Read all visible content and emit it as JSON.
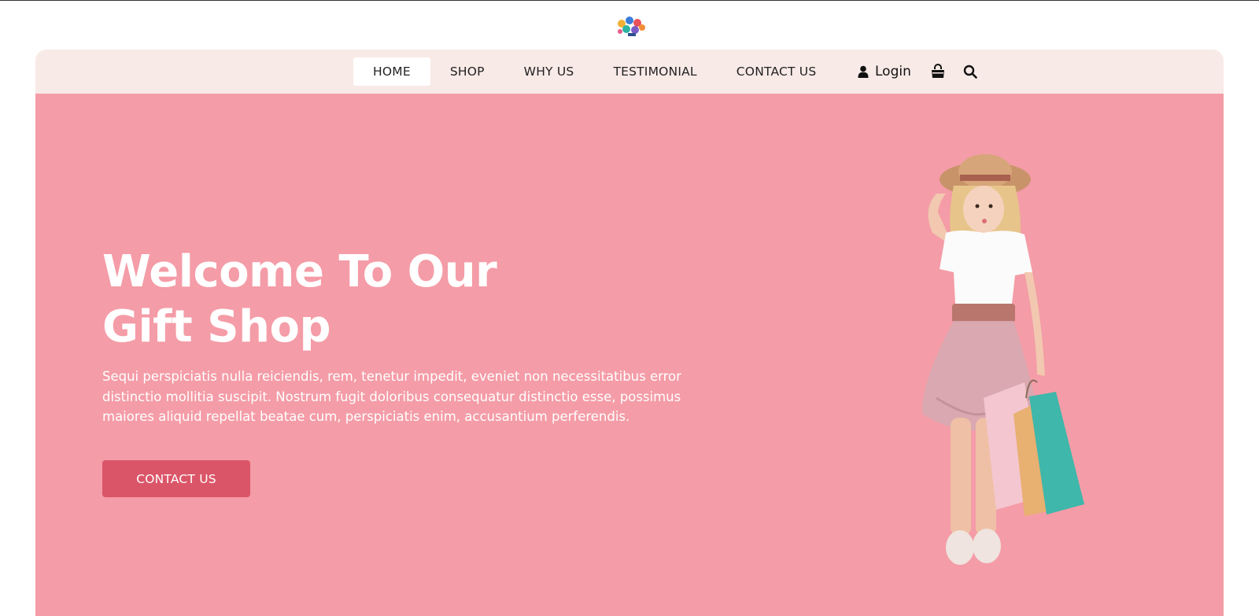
{
  "brand": {
    "logo_icon": "colorful-gift-logo-icon"
  },
  "nav": {
    "items": [
      {
        "label": "HOME",
        "active": true
      },
      {
        "label": "SHOP",
        "active": false
      },
      {
        "label": "WHY US",
        "active": false
      },
      {
        "label": "TESTIMONIAL",
        "active": false
      },
      {
        "label": "CONTACT US",
        "active": false
      }
    ],
    "login_label": "Login",
    "login_icon": "user-icon",
    "cart_icon": "shopping-bag-icon",
    "search_icon": "search-icon"
  },
  "hero": {
    "title_line1": "Welcome To Our",
    "title_line2": "Gift Shop",
    "description": "Sequi perspiciatis nulla reiciendis, rem, tenetur impedit, eveniet non necessitatibus error distinctio mollitia suscipit. Nostrum fugit doloribus consequatur distinctio esse, possimus maiores aliquid repellat beatae cum, perspiciatis enim, accusantium perferendis.",
    "cta_label": "CONTACT US",
    "image": "girl-with-shopping-bags-image"
  },
  "colors": {
    "nav_bg": "#f8eae7",
    "hero_bg": "#f49ca7",
    "cta_bg": "#db5568"
  }
}
